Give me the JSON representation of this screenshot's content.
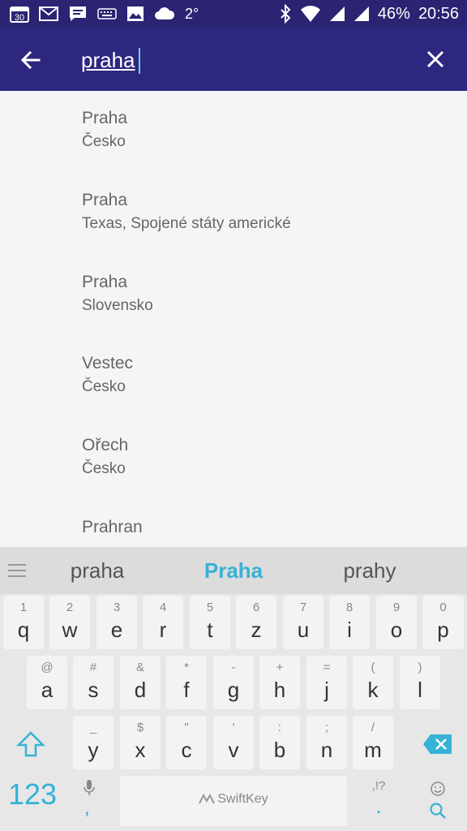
{
  "status_bar": {
    "calendar_day": "30",
    "temperature": "2°",
    "battery": "46%",
    "time": "20:56"
  },
  "toolbar": {
    "search_value": "praha"
  },
  "results": [
    {
      "city": "Praha",
      "region": "Česko"
    },
    {
      "city": "Praha",
      "region": "Texas, Spojené státy americké"
    },
    {
      "city": "Praha",
      "region": "Slovensko"
    },
    {
      "city": "Vestec",
      "region": "Česko"
    },
    {
      "city": "Ořech",
      "region": "Česko"
    },
    {
      "city": "Prahran",
      "region": ""
    }
  ],
  "keyboard": {
    "suggestions": [
      "praha",
      "Praha",
      "prahy"
    ],
    "row1": [
      {
        "hint": "1",
        "key": "q"
      },
      {
        "hint": "2",
        "key": "w"
      },
      {
        "hint": "3",
        "key": "e"
      },
      {
        "hint": "4",
        "key": "r"
      },
      {
        "hint": "5",
        "key": "t"
      },
      {
        "hint": "6",
        "key": "z"
      },
      {
        "hint": "7",
        "key": "u"
      },
      {
        "hint": "8",
        "key": "i"
      },
      {
        "hint": "9",
        "key": "o"
      },
      {
        "hint": "0",
        "key": "p"
      }
    ],
    "row2": [
      {
        "hint": "@",
        "key": "a"
      },
      {
        "hint": "#",
        "key": "s"
      },
      {
        "hint": "&",
        "key": "d"
      },
      {
        "hint": "*",
        "key": "f"
      },
      {
        "hint": "-",
        "key": "g"
      },
      {
        "hint": "+",
        "key": "h"
      },
      {
        "hint": "=",
        "key": "j"
      },
      {
        "hint": "(",
        "key": "k"
      },
      {
        "hint": ")",
        "key": "l"
      }
    ],
    "row3": [
      {
        "hint": "_",
        "key": "y"
      },
      {
        "hint": "$",
        "key": "x"
      },
      {
        "hint": "\"",
        "key": "c"
      },
      {
        "hint": "'",
        "key": "v"
      },
      {
        "hint": ":",
        "key": "b"
      },
      {
        "hint": ";",
        "key": "n"
      },
      {
        "hint": "/",
        "key": "m"
      }
    ],
    "num_label": "123",
    "mic_comma": ",",
    "space_label": "SwiftKey",
    "punct_top": ",!?",
    "punct_main": ".",
    "accent_color": "#35b2d6"
  }
}
